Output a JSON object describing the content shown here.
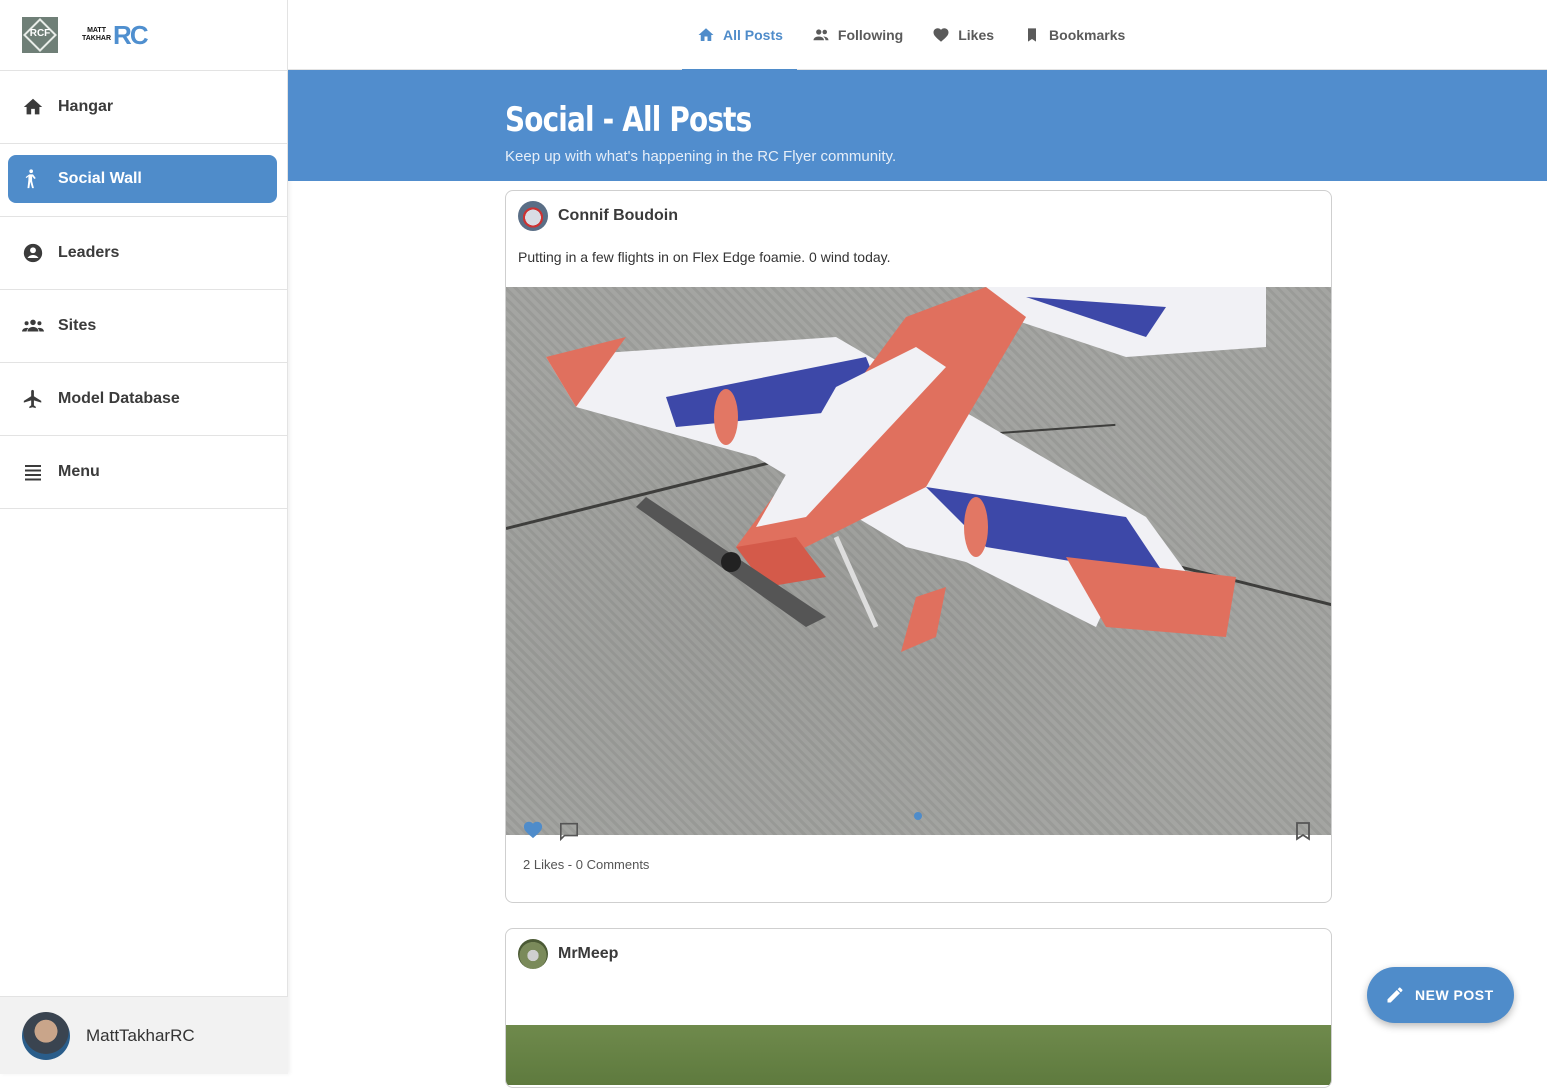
{
  "sidebar": {
    "logos": {
      "rcf_text": "RCF",
      "brand_line1": "MATT",
      "brand_line2": "TAKHAR",
      "brand_rc": "RC"
    },
    "items": [
      {
        "label": "Hangar",
        "icon": "home-icon"
      },
      {
        "label": "Social Wall",
        "icon": "person-walking-icon",
        "active": true
      },
      {
        "label": "Leaders",
        "icon": "account-circle-icon"
      },
      {
        "label": "Sites",
        "icon": "group-icon"
      },
      {
        "label": "Model Database",
        "icon": "airplane-icon"
      },
      {
        "label": "Menu",
        "icon": "menu-icon"
      }
    ],
    "user": {
      "name": "MattTakharRC"
    }
  },
  "tabs": [
    {
      "label": "All Posts",
      "icon": "home-icon",
      "active": true
    },
    {
      "label": "Following",
      "icon": "group-icon"
    },
    {
      "label": "Likes",
      "icon": "heart-icon"
    },
    {
      "label": "Bookmarks",
      "icon": "bookmark-icon"
    }
  ],
  "banner": {
    "title": "Social - All Posts",
    "subtitle": "Keep up with what's happening in the RC Flyer community."
  },
  "posts": [
    {
      "author": "Connif Boudoin",
      "text": "Putting in a few flights in on Flex Edge foamie. 0 wind today.",
      "stats": "2 Likes - 0 Comments",
      "liked": true
    },
    {
      "author": "MrMeep",
      "text": ""
    }
  ],
  "fab": {
    "label": "NEW POST",
    "icon": "pencil-icon"
  },
  "colors": {
    "accent": "#4f8cca",
    "banner": "#518dcd"
  }
}
